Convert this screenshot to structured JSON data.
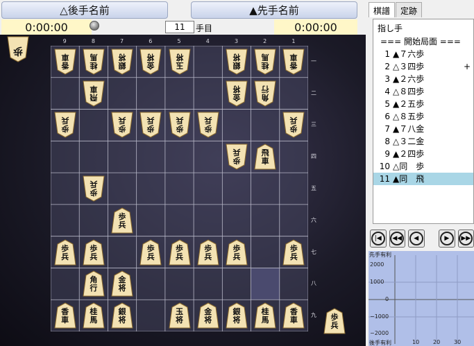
{
  "header": {
    "gote_name": "△後手名前",
    "sente_name": "▲先手名前",
    "gote_time": "0:00:00",
    "sente_time": "0:00:00",
    "move_number": "11",
    "move_unit": "手目"
  },
  "board": {
    "file_labels": [
      "9",
      "8",
      "7",
      "6",
      "5",
      "4",
      "3",
      "2",
      "1"
    ],
    "rank_labels": [
      "一",
      "二",
      "三",
      "四",
      "五",
      "六",
      "七",
      "八",
      "九"
    ],
    "pieces": [
      {
        "side": "gote",
        "file": 9,
        "rank": 1,
        "text": "香車"
      },
      {
        "side": "gote",
        "file": 8,
        "rank": 1,
        "text": "桂馬"
      },
      {
        "side": "gote",
        "file": 7,
        "rank": 1,
        "text": "銀将"
      },
      {
        "side": "gote",
        "file": 6,
        "rank": 1,
        "text": "金将"
      },
      {
        "side": "gote",
        "file": 5,
        "rank": 1,
        "text": "玉将"
      },
      {
        "side": "gote",
        "file": 3,
        "rank": 1,
        "text": "銀将"
      },
      {
        "side": "gote",
        "file": 2,
        "rank": 1,
        "text": "桂馬"
      },
      {
        "side": "gote",
        "file": 1,
        "rank": 1,
        "text": "香車"
      },
      {
        "side": "gote",
        "file": 8,
        "rank": 2,
        "text": "飛車"
      },
      {
        "side": "gote",
        "file": 3,
        "rank": 2,
        "text": "金将"
      },
      {
        "side": "gote",
        "file": 2,
        "rank": 2,
        "text": "角行"
      },
      {
        "side": "gote",
        "file": 9,
        "rank": 3,
        "text": "歩兵"
      },
      {
        "side": "gote",
        "file": 7,
        "rank": 3,
        "text": "歩兵"
      },
      {
        "side": "gote",
        "file": 6,
        "rank": 3,
        "text": "歩兵"
      },
      {
        "side": "gote",
        "file": 5,
        "rank": 3,
        "text": "歩兵"
      },
      {
        "side": "gote",
        "file": 4,
        "rank": 3,
        "text": "歩兵"
      },
      {
        "side": "gote",
        "file": 1,
        "rank": 3,
        "text": "歩兵"
      },
      {
        "side": "gote",
        "file": 3,
        "rank": 4,
        "text": "歩兵"
      },
      {
        "side": "gote",
        "file": 8,
        "rank": 5,
        "text": "歩兵"
      },
      {
        "side": "sente",
        "file": 2,
        "rank": 4,
        "text": "飛車",
        "highlight": true
      },
      {
        "side": "sente",
        "file": 7,
        "rank": 6,
        "text": "歩兵"
      },
      {
        "side": "sente",
        "file": 9,
        "rank": 7,
        "text": "歩兵"
      },
      {
        "side": "sente",
        "file": 8,
        "rank": 7,
        "text": "歩兵"
      },
      {
        "side": "sente",
        "file": 6,
        "rank": 7,
        "text": "歩兵"
      },
      {
        "side": "sente",
        "file": 5,
        "rank": 7,
        "text": "歩兵"
      },
      {
        "side": "sente",
        "file": 4,
        "rank": 7,
        "text": "歩兵"
      },
      {
        "side": "sente",
        "file": 3,
        "rank": 7,
        "text": "歩兵"
      },
      {
        "side": "sente",
        "file": 1,
        "rank": 7,
        "text": "歩兵"
      },
      {
        "side": "sente",
        "file": 8,
        "rank": 8,
        "text": "角行"
      },
      {
        "side": "sente",
        "file": 7,
        "rank": 8,
        "text": "金将"
      },
      {
        "side": "sente",
        "file": 9,
        "rank": 9,
        "text": "香車"
      },
      {
        "side": "sente",
        "file": 8,
        "rank": 9,
        "text": "桂馬"
      },
      {
        "side": "sente",
        "file": 7,
        "rank": 9,
        "text": "銀将"
      },
      {
        "side": "sente",
        "file": 5,
        "rank": 9,
        "text": "玉将"
      },
      {
        "side": "sente",
        "file": 4,
        "rank": 9,
        "text": "金将"
      },
      {
        "side": "sente",
        "file": 3,
        "rank": 9,
        "text": "銀将"
      },
      {
        "side": "sente",
        "file": 2,
        "rank": 9,
        "text": "桂馬"
      },
      {
        "side": "sente",
        "file": 1,
        "rank": 9,
        "text": "香車"
      }
    ],
    "gote_hand": [
      {
        "text": "歩"
      }
    ],
    "sente_hand": [
      {
        "text": "歩兵"
      }
    ],
    "last_move_from": {
      "file": 2,
      "rank": 8
    }
  },
  "tabs": [
    {
      "label": "棋譜",
      "active": true
    },
    {
      "label": "定跡",
      "active": false
    }
  ],
  "kifu": {
    "header": "指し手",
    "start_line": "=== 開始局面 ===",
    "moves": [
      {
        "num": "1",
        "text": "▲７六歩"
      },
      {
        "num": "2",
        "text": "△３四歩",
        "mark": "+"
      },
      {
        "num": "3",
        "text": "▲２六歩"
      },
      {
        "num": "4",
        "text": "△８四歩"
      },
      {
        "num": "5",
        "text": "▲２五歩"
      },
      {
        "num": "6",
        "text": "△８五歩"
      },
      {
        "num": "7",
        "text": "▲７八金"
      },
      {
        "num": "8",
        "text": "△３二金"
      },
      {
        "num": "9",
        "text": "▲２四歩"
      },
      {
        "num": "10",
        "text": "△同　歩"
      },
      {
        "num": "11",
        "text": "▲同　飛",
        "selected": true
      }
    ]
  },
  "nav": {
    "first_icon": "skip-start-icon",
    "back10_icon": "rewind-icon",
    "back_icon": "step-back-icon",
    "forward_icon": "step-forward-icon",
    "last_icon": "fast-forward-icon"
  },
  "graph": {
    "top_label": "先手有利",
    "bottom_label": "後手有利",
    "y_ticks": [
      "2000",
      "1000",
      "0",
      "−1000",
      "−2000"
    ],
    "x_ticks": [
      "10",
      "20",
      "30"
    ]
  },
  "colors": {
    "highlight_square": "#4a4a6e",
    "selected_row": "#a9d6e6",
    "graph_bg": "#b0bfe8"
  }
}
